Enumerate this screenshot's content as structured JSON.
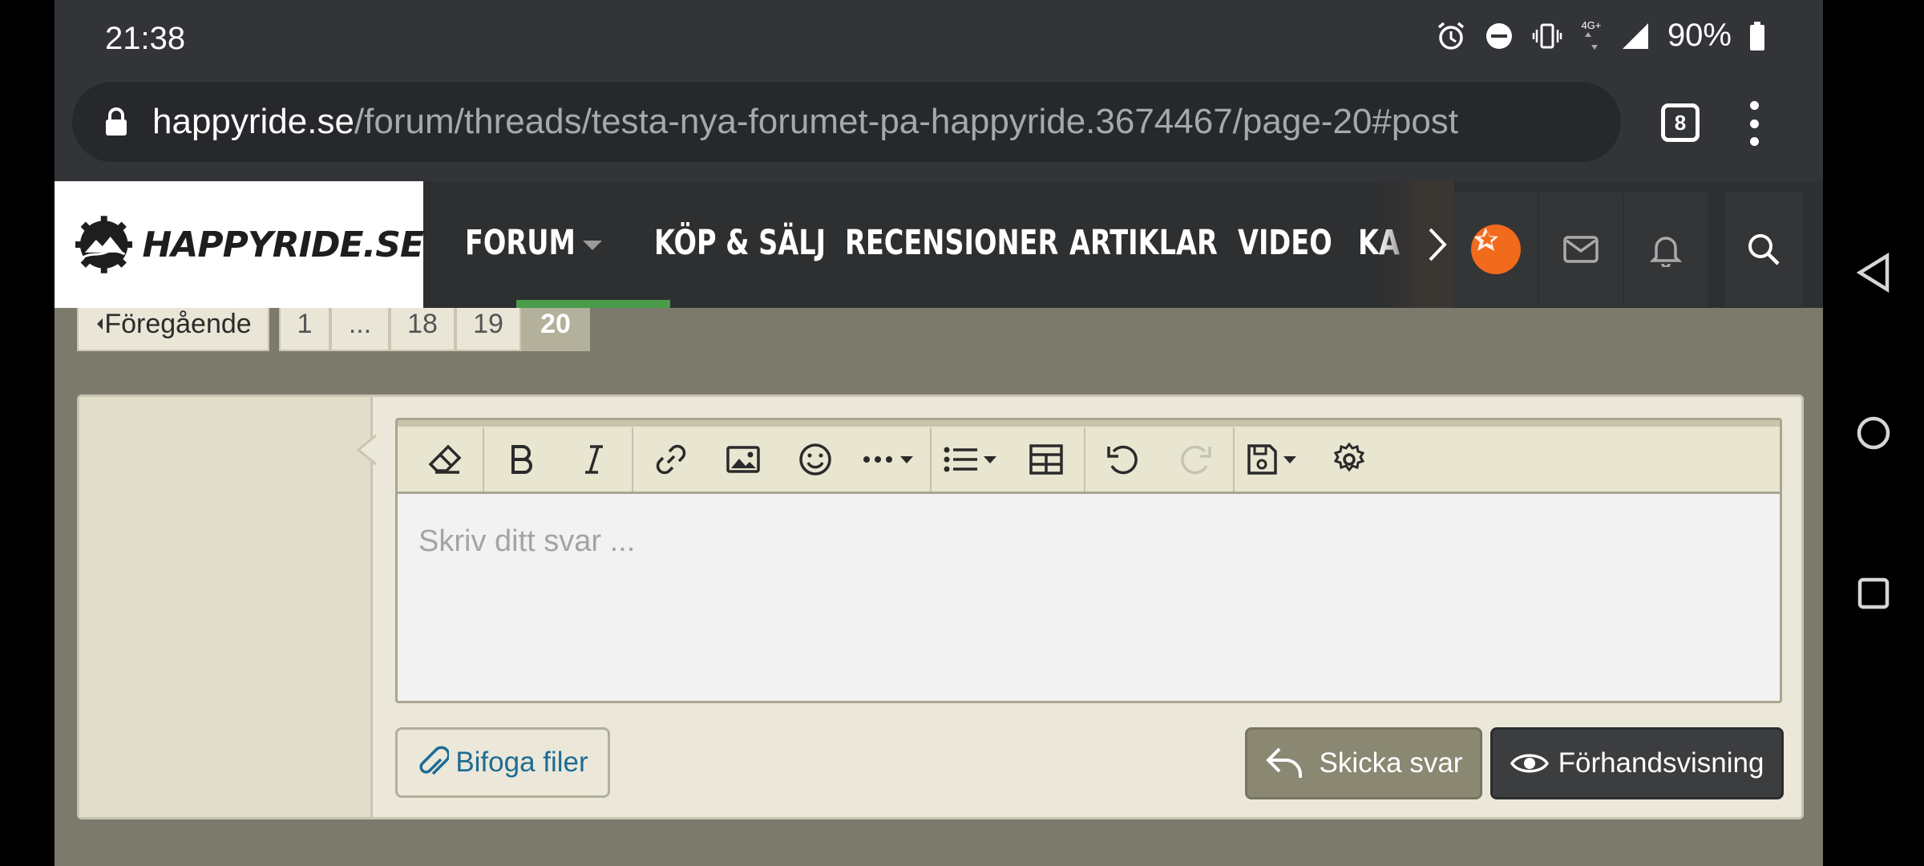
{
  "status_bar": {
    "time": "21:38",
    "network": "4G+",
    "battery": "90%",
    "icons": [
      "alarm-icon",
      "dnd-icon",
      "vibrate-icon",
      "data-arrows-icon",
      "signal-icon",
      "battery-icon"
    ]
  },
  "browser": {
    "url_domain": "happyride.se",
    "url_path": "/forum/threads/testa-nya-forumet-pa-happyride.3674467/page-20#post",
    "tab_count": "8"
  },
  "site": {
    "logo_text": "HAPPYRIDE.SE",
    "nav": [
      {
        "label": "FORUM"
      },
      {
        "label": "KÖP & SÄLJ"
      },
      {
        "label": "RECENSIONER"
      },
      {
        "label": "ARTIKLAR"
      },
      {
        "label": "VIDEO"
      },
      {
        "label": "KA"
      }
    ],
    "accent_color": "#4a9b4a",
    "avatar_color": "#f26a1b"
  },
  "pagination": {
    "prev_label": "Föregående",
    "pages": [
      "1",
      "...",
      "18",
      "19",
      "20"
    ],
    "current": "20"
  },
  "editor": {
    "placeholder": "Skriv ditt svar ...",
    "toolbar": [
      "eraser-icon",
      "bold-icon",
      "italic-icon",
      "link-icon",
      "image-icon",
      "smiley-icon",
      "more-icon",
      "list-icon",
      "table-icon",
      "undo-icon",
      "redo-icon",
      "save-draft-icon",
      "settings-icon"
    ]
  },
  "actions": {
    "attach_label": "Bifoga filer",
    "send_label": "Skicka svar",
    "preview_label": "Förhandsvisning"
  }
}
